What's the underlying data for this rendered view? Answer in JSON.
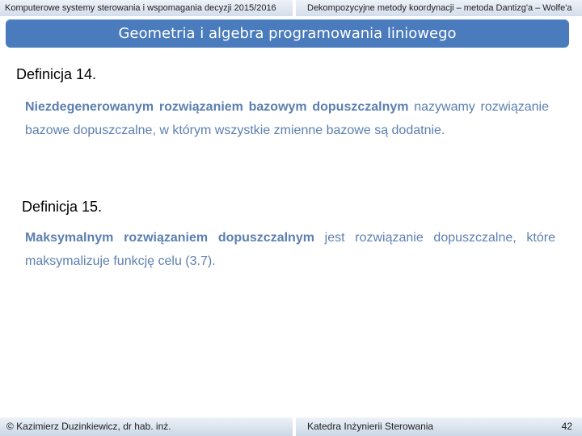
{
  "header": {
    "left": "Komputerowe  systemy sterowania i wspomagania decyzji 2015/2016",
    "right": "Dekompozycyjne metody koordynacji – metoda Dantizg'a – Wolfe'a"
  },
  "title": "Geometria  i algebra programowania liniowego",
  "definitions": [
    {
      "heading": "Definicja 14.",
      "bold": "Niezdegenerowanym rozwiązaniem bazowym dopuszczalnym",
      "text": " nazywamy rozwiązanie bazowe dopuszczalne, w którym wszystkie zmienne bazowe są dodatnie."
    },
    {
      "heading": "Definicja 15.",
      "bold": "Maksymalnym rozwiązaniem dopuszczalnym",
      "text": " jest rozwiązanie dopuszczalne, które maksymalizuje funkcję celu (3.7)."
    }
  ],
  "footer": {
    "author": "©  Kazimierz Duzinkiewicz, dr hab. inż.",
    "department": "Katedra Inżynierii Sterowania",
    "page": "42"
  }
}
